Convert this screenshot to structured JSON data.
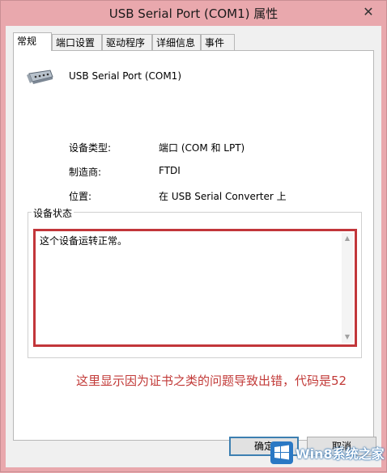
{
  "window": {
    "title": "USB Serial Port (COM1) 属性",
    "close_glyph": "✕"
  },
  "tabs": [
    {
      "label": "常规",
      "active": true
    },
    {
      "label": "端口设置",
      "active": false
    },
    {
      "label": "驱动程序",
      "active": false
    },
    {
      "label": "详细信息",
      "active": false
    },
    {
      "label": "事件",
      "active": false
    }
  ],
  "device": {
    "name": "USB Serial Port (COM1)",
    "icon": "serial-port-icon",
    "properties": [
      {
        "label": "设备类型:",
        "value": "端口 (COM 和 LPT)"
      },
      {
        "label": "制造商:",
        "value": "FTDI"
      },
      {
        "label": "位置:",
        "value": "在 USB Serial Converter 上"
      }
    ]
  },
  "status": {
    "group_label": "设备状态",
    "text": "这个设备运转正常。",
    "highlight_color": "#c2363a"
  },
  "annotation": {
    "text": "这里显示因为证书之类的问题导致出错，代码是52",
    "color": "#c23a38"
  },
  "buttons": {
    "ok_label": "确定",
    "cancel_label": "取消"
  },
  "watermark": {
    "text": "Win8系统之家",
    "icon": "windows-logo-icon"
  }
}
